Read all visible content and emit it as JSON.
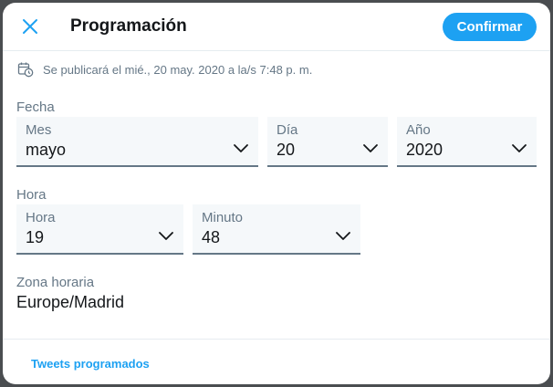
{
  "header": {
    "title": "Programación",
    "confirm_label": "Confirmar",
    "close_icon": "close-icon"
  },
  "notice": {
    "icon": "calendar-clock-icon",
    "text": "Se publicará el mié., 20 may. 2020 a la/s 7:48 p. m."
  },
  "date": {
    "section_label": "Fecha",
    "month": {
      "label": "Mes",
      "value": "mayo"
    },
    "day": {
      "label": "Día",
      "value": "20"
    },
    "year": {
      "label": "Año",
      "value": "2020"
    }
  },
  "time": {
    "section_label": "Hora",
    "hour": {
      "label": "Hora",
      "value": "19"
    },
    "minute": {
      "label": "Minuto",
      "value": "48"
    }
  },
  "timezone": {
    "section_label": "Zona horaria",
    "value": "Europe/Madrid"
  },
  "footer": {
    "link_label": "Tweets programados"
  },
  "colors": {
    "accent": "#1da1f2",
    "text_primary": "#14171a",
    "text_secondary": "#657786",
    "field_bg": "#f5f8fa"
  }
}
